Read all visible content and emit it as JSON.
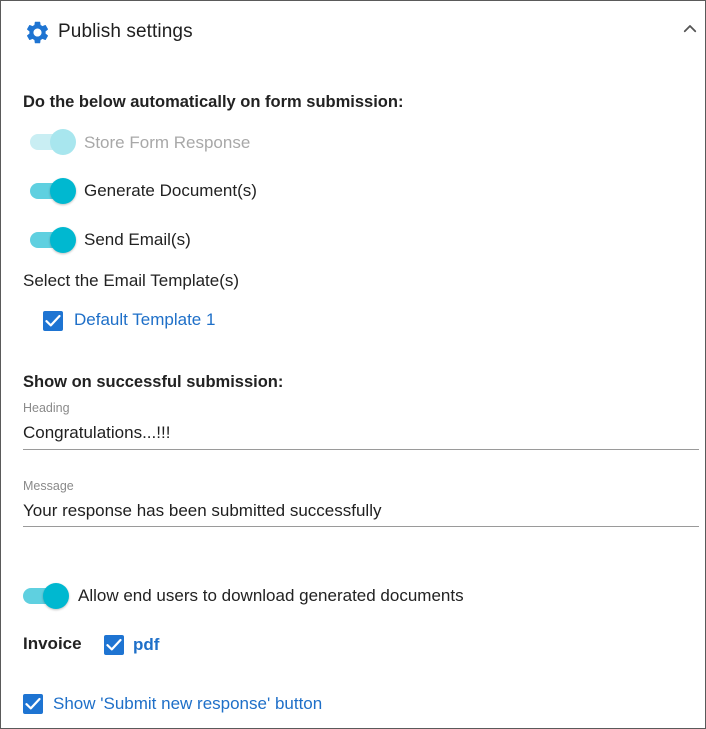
{
  "header": {
    "title": "Publish settings",
    "icon": "gear-icon",
    "collapse_icon": "chevron-up-icon"
  },
  "auto_section": {
    "title": "Do the below automatically on form submission:",
    "toggles": [
      {
        "label": "Store Form Response",
        "on": true,
        "disabled": true
      },
      {
        "label": "Generate Document(s)",
        "on": true,
        "disabled": false
      },
      {
        "label": "Send Email(s)",
        "on": true,
        "disabled": false
      }
    ],
    "email_template_label": "Select the Email Template(s)",
    "email_templates": [
      {
        "label": "Default Template 1",
        "checked": true
      }
    ]
  },
  "success_section": {
    "title": "Show on successful submission:",
    "heading_field": {
      "label": "Heading",
      "value": "Congratulations...!!!"
    },
    "message_field": {
      "label": "Message",
      "value": "Your response has been submitted successfully"
    }
  },
  "download": {
    "toggle_label": "Allow end users to download generated documents",
    "on": true,
    "invoice_label": "Invoice",
    "format_label": "pdf",
    "format_checked": true
  },
  "submit_new": {
    "label": "Show 'Submit new response' button",
    "checked": true
  },
  "colors": {
    "accent": "#00b8d0",
    "track": "#5fd0e0",
    "checkbox": "#1e74d2",
    "link": "#1e6fc8",
    "gear": "#1e74d2"
  }
}
